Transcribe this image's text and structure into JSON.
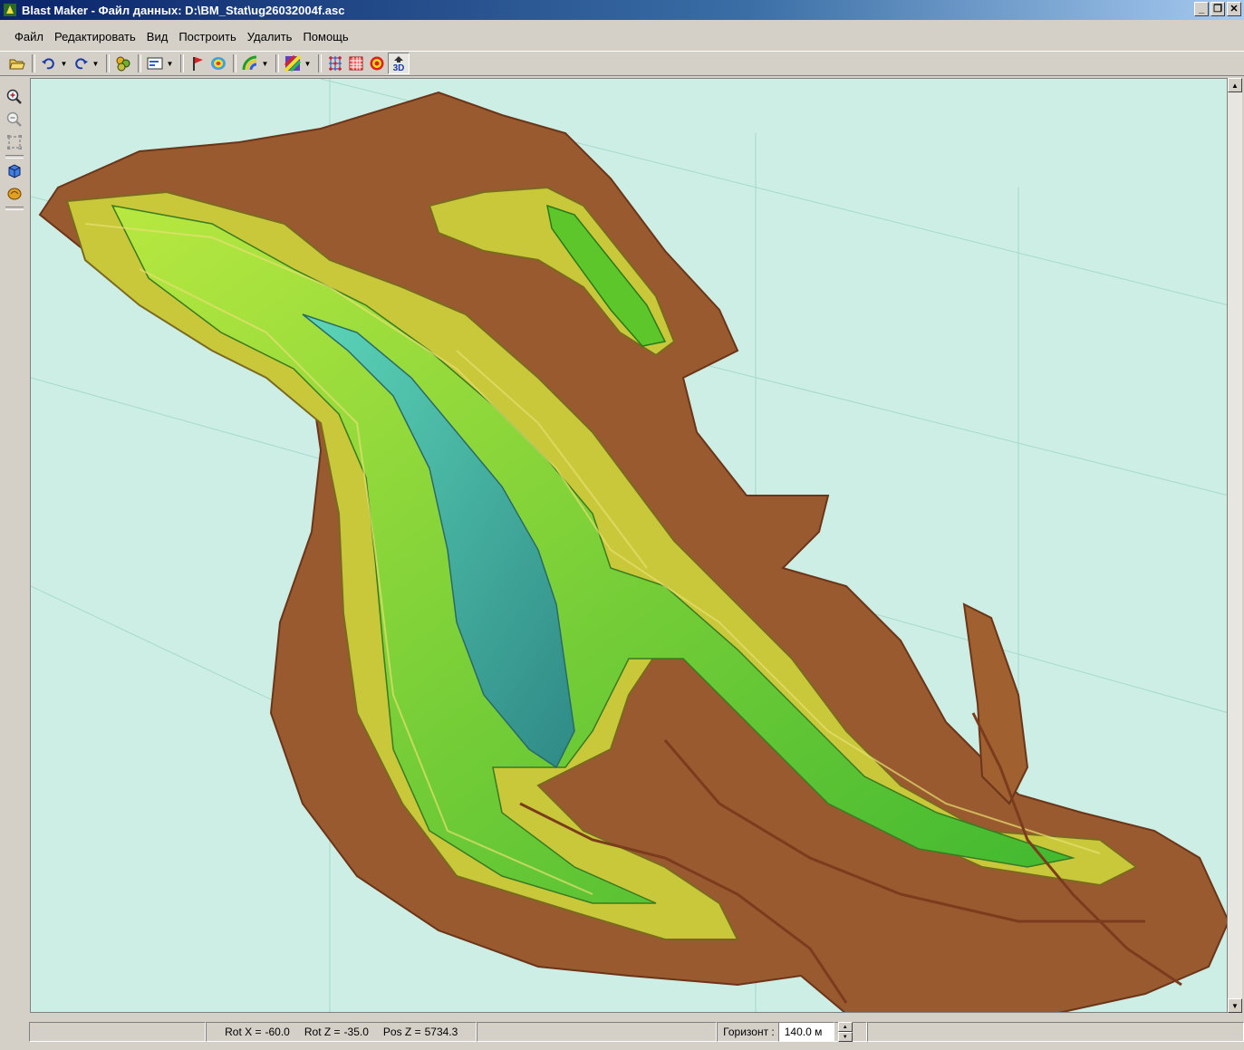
{
  "window": {
    "title": "Blast Maker - Файл данных: D:\\BM_Stat\\ug26032004f.asc"
  },
  "menu": [
    {
      "label": "Файл"
    },
    {
      "label": "Редактировать"
    },
    {
      "label": "Вид"
    },
    {
      "label": "Построить"
    },
    {
      "label": "Удалить"
    },
    {
      "label": "Помощь"
    }
  ],
  "toolbar": {
    "icons": [
      "open-folder-icon",
      "undo-icon",
      "redo-icon",
      "layers-icon",
      "display-mode-icon",
      "flag-icon",
      "contour-icon",
      "color-scheme-icon",
      "gradient-icon",
      "grid-points-icon",
      "grid-table-icon",
      "target-icon",
      "view-3d-icon"
    ],
    "view3d_label": "3D"
  },
  "side_toolbar": {
    "icons": [
      "zoom-in-icon",
      "zoom-out-icon",
      "zoom-extent-icon",
      "view-cube-icon",
      "rotate-object-icon"
    ]
  },
  "colors": {
    "background": "#cdeee4",
    "terrain_low": "#8b4a25",
    "terrain_mid": "#c9c83a",
    "terrain_green": "#5cc62a",
    "terrain_deep": "#3fa59a"
  },
  "status": {
    "rotx_label": "Rot X =",
    "rotx_value": "-60.0",
    "rotz_label": "Rot Z =",
    "rotz_value": "-35.0",
    "posz_label": "Pos Z =",
    "posz_value": "5734.3",
    "horizon_label": "Горизонт :",
    "horizon_value": "140.0 м"
  }
}
